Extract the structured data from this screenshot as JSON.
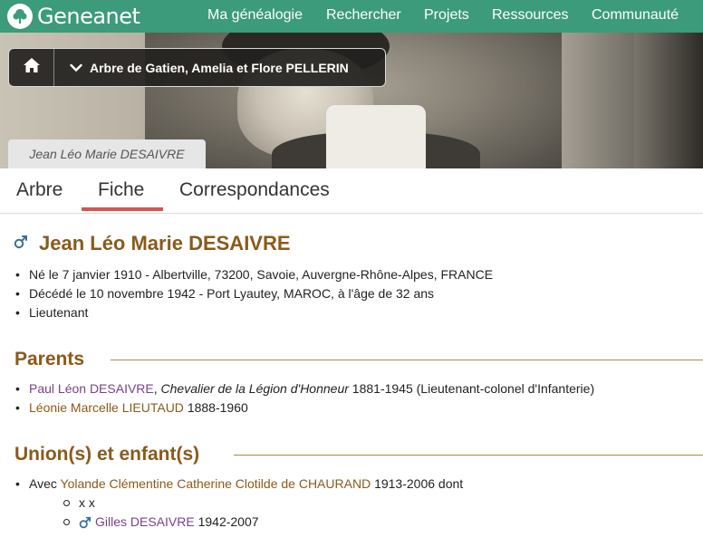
{
  "nav": {
    "logo_text": "Geneanet",
    "items": [
      "Ma généalogie",
      "Rechercher",
      "Projets",
      "Ressources",
      "Communauté"
    ]
  },
  "breadcrumb": {
    "home_icon": "home-icon",
    "chevron_icon": "chevron-down-icon",
    "tree_label": "Arbre de Gatien, Amelia et Flore PELLERIN"
  },
  "person_tab": "Jean Léo Marie DESAIVRE",
  "tabs": {
    "items": [
      "Arbre",
      "Fiche",
      "Correspondances"
    ],
    "active": "Fiche"
  },
  "person": {
    "gender_icon": "male-icon",
    "name": "Jean Léo Marie DESAIVRE",
    "facts": [
      "Né le 7 janvier 1910 - Albertville, 73200, Savoie, Auvergne-Rhône-Alpes, FRANCE",
      "Décédé le 10 novembre 1942 - Port Lyautey, MAROC, à l'âge de 32 ans",
      "Lieutenant"
    ]
  },
  "parents": {
    "title": "Parents",
    "father": {
      "name": "Paul Léon DESAIVRE",
      "separator": ",",
      "title": "Chevalier de la Légion d'Honneur",
      "details": "1881-1945 (Lieutenant-colonel d'Infanterie)"
    },
    "mother": {
      "name": "Léonie Marcelle LIEUTAUD",
      "details": "1888-1960"
    }
  },
  "unions": {
    "title": "Union(s) et enfant(s)",
    "union": {
      "prefix": "Avec",
      "spouse": "Yolande Clémentine Catherine Clotilde de CHAURAND",
      "details": "1913-2006 dont"
    },
    "children": [
      {
        "text": "x x"
      },
      {
        "gender_icon": "male-icon",
        "name": "Gilles DESAIVRE",
        "details": "1942-2007"
      }
    ]
  },
  "colors": {
    "topbar": "#3c9b7a",
    "heading_brown": "#8a5a1a",
    "link_purple": "#7a3f8a",
    "tab_underline": "#d9534f",
    "male_icon": "#3a6e9a"
  }
}
